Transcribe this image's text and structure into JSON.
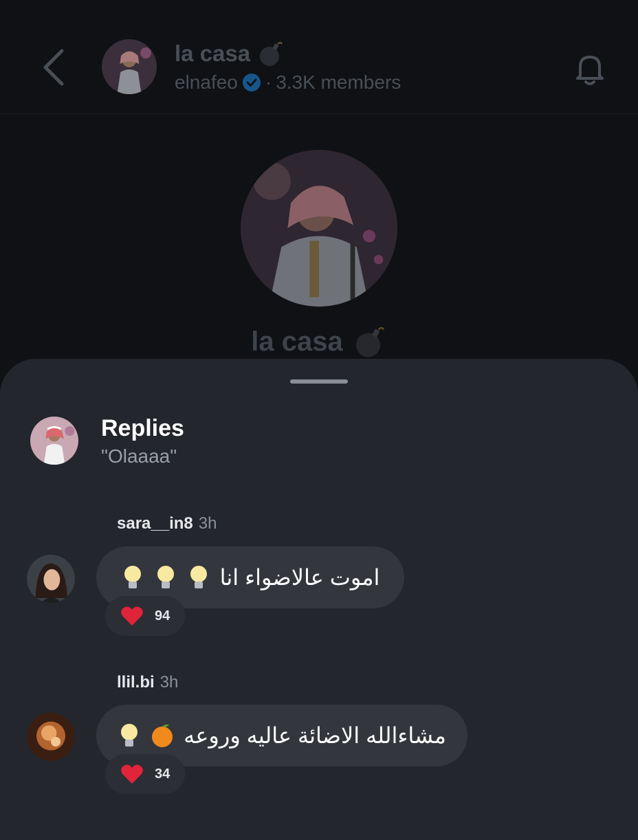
{
  "header": {
    "title": "la casa",
    "owner": "elnafeo",
    "separator": "·",
    "members": "3.3K members"
  },
  "profile": {
    "title": "la casa"
  },
  "sheet": {
    "title": "Replies",
    "quote": "\"Olaaaa\""
  },
  "replies": [
    {
      "username": "sara__in8",
      "time": "3h",
      "text": "اموت عالاضواء انا",
      "reaction_count": "94"
    },
    {
      "username": "llil.bi",
      "time": "3h",
      "text": "مشاءالله الاضائة عاليه وروعه",
      "reaction_count": "34"
    }
  ],
  "colors": {
    "accent_verified": "#1d9bf0",
    "reaction_heart": "#e0243a"
  }
}
